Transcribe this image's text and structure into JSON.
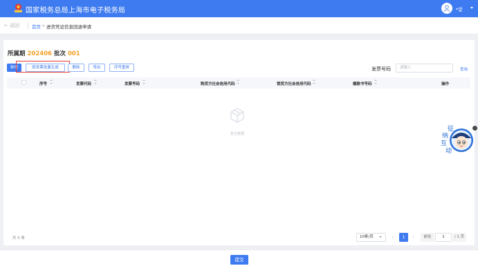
{
  "topbar": {
    "title": "国家税务总局上海市电子税务局",
    "username": "*堂",
    "logo_icon": "tax-emblem-icon",
    "avatar_icon": "user-avatar-icon"
  },
  "subbar": {
    "back_label": "← 返回",
    "breadcrumb": {
      "home": "首页",
      "separator": ">",
      "current": "进货凭证信息回退申请"
    }
  },
  "period": {
    "label": "所属期",
    "value": "202406",
    "batch_label": "批次",
    "batch_value": "001"
  },
  "toolbar": {
    "new_label": "新增",
    "batch_generate_label": "按发票批量生成",
    "delete_label": "删除",
    "export_label": "导出",
    "move_label": "序号重排"
  },
  "search": {
    "label": "发票号码",
    "placeholder": "请输入",
    "query_label": "查询"
  },
  "table": {
    "columns": [
      "序号",
      "发票代码",
      "发票号码",
      "购货方社会信用代码",
      "销货方社会信用代码",
      "缴款书号码",
      "操作"
    ],
    "rows": [],
    "empty_text": "暂无数据"
  },
  "pagination": {
    "total_label": "共 0 条",
    "page_size": "10条/页",
    "current_page": "1",
    "goto_label": "前往",
    "goto_value": "1",
    "total_pages": "/ 1 页"
  },
  "footer": {
    "submit_label": "提交"
  },
  "assistant": {
    "icon": "tax-assistant-mascot-icon",
    "text": "征纳互动"
  },
  "colors": {
    "primary": "#3e7bf0",
    "highlight_border": "#e23b2e",
    "period_value": "#f2a025"
  }
}
